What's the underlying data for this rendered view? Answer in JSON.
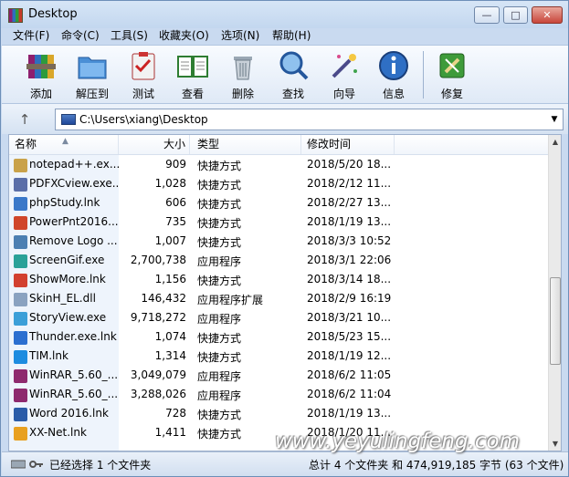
{
  "window": {
    "title": "Desktop",
    "min": "—",
    "max": "□",
    "close": "✕"
  },
  "menu": [
    "文件(F)",
    "命令(C)",
    "工具(S)",
    "收藏夹(O)",
    "选项(N)",
    "帮助(H)"
  ],
  "toolbar": [
    {
      "label": "添加",
      "icon": "books-add-icon"
    },
    {
      "label": "解压到",
      "icon": "folder-extract-icon"
    },
    {
      "label": "测试",
      "icon": "clipboard-test-icon"
    },
    {
      "label": "查看",
      "icon": "open-book-icon"
    },
    {
      "label": "删除",
      "icon": "trash-icon"
    },
    {
      "label": "查找",
      "icon": "magnifier-icon"
    },
    {
      "label": "向导",
      "icon": "wand-icon"
    },
    {
      "label": "信息",
      "icon": "info-icon"
    },
    {
      "label": "修复",
      "icon": "repair-kit-icon"
    }
  ],
  "address": {
    "path": "C:\\Users\\xiang\\Desktop"
  },
  "columns": {
    "name": "名称",
    "size": "大小",
    "type": "类型",
    "modified": "修改时间"
  },
  "files": [
    {
      "name": "notepad++.ex...",
      "size": "909",
      "type": "快捷方式",
      "modified": "2018/5/20 18...",
      "color": "#c9a24a"
    },
    {
      "name": "PDFXCview.exe...",
      "size": "1,028",
      "type": "快捷方式",
      "modified": "2018/2/12 11...",
      "color": "#5b6fa8"
    },
    {
      "name": "phpStudy.lnk",
      "size": "606",
      "type": "快捷方式",
      "modified": "2018/2/27 13...",
      "color": "#3a78c9"
    },
    {
      "name": "PowerPnt2016....",
      "size": "735",
      "type": "快捷方式",
      "modified": "2018/1/19 13...",
      "color": "#d0462a"
    },
    {
      "name": "Remove Logo ...",
      "size": "1,007",
      "type": "快捷方式",
      "modified": "2018/3/3 10:52",
      "color": "#4c7fb2"
    },
    {
      "name": "ScreenGif.exe",
      "size": "2,700,738",
      "type": "应用程序",
      "modified": "2018/3/1 22:06",
      "color": "#2aa198"
    },
    {
      "name": "ShowMore.lnk",
      "size": "1,156",
      "type": "快捷方式",
      "modified": "2018/3/14 18...",
      "color": "#d2402f"
    },
    {
      "name": "SkinH_EL.dll",
      "size": "146,432",
      "type": "应用程序扩展",
      "modified": "2018/2/9 16:19",
      "color": "#8aa2c0"
    },
    {
      "name": "StoryView.exe",
      "size": "9,718,272",
      "type": "应用程序",
      "modified": "2018/3/21 10...",
      "color": "#3c9fd8"
    },
    {
      "name": "Thunder.exe.lnk",
      "size": "1,074",
      "type": "快捷方式",
      "modified": "2018/5/23 15...",
      "color": "#2c6fd0"
    },
    {
      "name": "TIM.lnk",
      "size": "1,314",
      "type": "快捷方式",
      "modified": "2018/1/19 12...",
      "color": "#1d8ce0"
    },
    {
      "name": "WinRAR_5.60_...",
      "size": "3,049,079",
      "type": "应用程序",
      "modified": "2018/6/2 11:05",
      "color": "#8e2a6e"
    },
    {
      "name": "WinRAR_5.60_...",
      "size": "3,288,026",
      "type": "应用程序",
      "modified": "2018/6/2 11:04",
      "color": "#8e2a6e"
    },
    {
      "name": "Word 2016.lnk",
      "size": "728",
      "type": "快捷方式",
      "modified": "2018/1/19 13...",
      "color": "#2b5ca8"
    },
    {
      "name": "XX-Net.lnk",
      "size": "1,411",
      "type": "快捷方式",
      "modified": "2018/1/20 11...",
      "color": "#e8a020"
    }
  ],
  "status": {
    "left": "已经选择 1 个文件夹",
    "right": "总计 4 个文件夹 和 474,919,185 字节 (63 个文件)"
  },
  "watermark": "www.yeyulingfeng.com"
}
